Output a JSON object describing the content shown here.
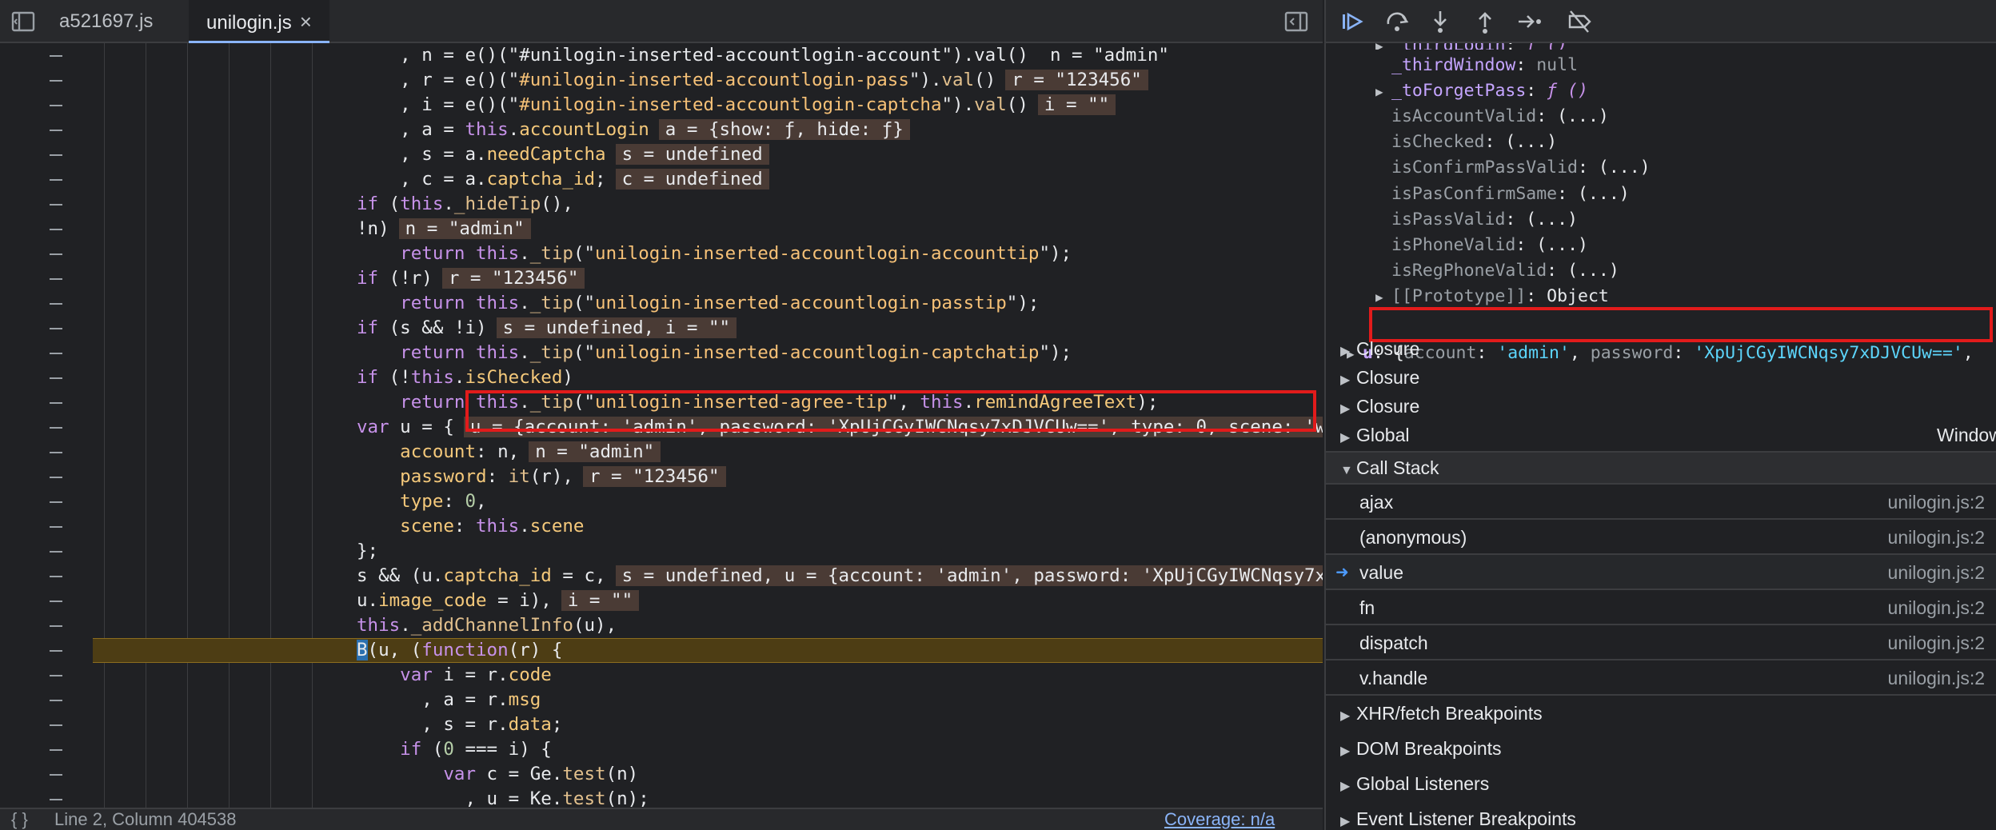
{
  "tabs": [
    {
      "label": "a521697.js",
      "active": false
    },
    {
      "label": "unilogin.js",
      "active": true,
      "close": "×"
    }
  ],
  "code_lines": [
    [
      [
        "pl",
        "    , n = e()(\"#unilogin-inserted-accountlogin-account\").val()  n = \"admin\""
      ]
    ],
    [
      [
        "pl",
        "    , r = e()(\""
      ],
      [
        "str",
        "#unilogin-inserted-accountlogin-pass"
      ],
      [
        "pl",
        "\")."
      ],
      [
        "fn",
        "val"
      ],
      [
        "pl",
        "()"
      ],
      [
        "inl",
        "r = \"123456\""
      ]
    ],
    [
      [
        "pl",
        "    , i = e()(\""
      ],
      [
        "str",
        "#unilogin-inserted-accountlogin-captcha"
      ],
      [
        "pl",
        "\")."
      ],
      [
        "fn",
        "val"
      ],
      [
        "pl",
        "()"
      ],
      [
        "inl",
        "i = \"\""
      ]
    ],
    [
      [
        "pl",
        "    , a = "
      ],
      [
        "kw",
        "this"
      ],
      [
        "pl",
        "."
      ],
      [
        "prop",
        "accountLogin"
      ],
      [
        "inl",
        "a = {show: ƒ, hide: ƒ}"
      ]
    ],
    [
      [
        "pl",
        "    , s = a."
      ],
      [
        "prop",
        "needCaptcha"
      ],
      [
        "inl",
        "s = undefined"
      ]
    ],
    [
      [
        "pl",
        "    , c = a."
      ],
      [
        "prop",
        "captcha_id"
      ],
      [
        "pl",
        ";"
      ],
      [
        "inl",
        "c = undefined"
      ]
    ],
    [
      [
        "kw",
        "if"
      ],
      [
        "pl",
        " ("
      ],
      [
        "kw",
        "this"
      ],
      [
        "pl",
        "."
      ],
      [
        "fn",
        "_hideTip"
      ],
      [
        "pl",
        "(),"
      ]
    ],
    [
      [
        "pl",
        "!n)"
      ],
      [
        "inl",
        "n = \"admin\""
      ]
    ],
    [
      [
        "kw",
        "    return this"
      ],
      [
        "pl",
        "."
      ],
      [
        "fn",
        "_tip"
      ],
      [
        "pl",
        "(\""
      ],
      [
        "str",
        "unilogin-inserted-accountlogin-accounttip"
      ],
      [
        "pl",
        "\");"
      ]
    ],
    [
      [
        "kw",
        "if"
      ],
      [
        "pl",
        " (!r)"
      ],
      [
        "inl",
        "r = \"123456\""
      ]
    ],
    [
      [
        "kw",
        "    return this"
      ],
      [
        "pl",
        "."
      ],
      [
        "fn",
        "_tip"
      ],
      [
        "pl",
        "(\""
      ],
      [
        "str",
        "unilogin-inserted-accountlogin-passtip"
      ],
      [
        "pl",
        "\");"
      ]
    ],
    [
      [
        "kw",
        "if"
      ],
      [
        "pl",
        " (s && !i)"
      ],
      [
        "inl",
        "s = undefined, i = \"\""
      ]
    ],
    [
      [
        "kw",
        "    return this"
      ],
      [
        "pl",
        "."
      ],
      [
        "fn",
        "_tip"
      ],
      [
        "pl",
        "(\""
      ],
      [
        "str",
        "unilogin-inserted-accountlogin-captchatip"
      ],
      [
        "pl",
        "\");"
      ]
    ],
    [
      [
        "kw",
        "if"
      ],
      [
        "pl",
        " (!"
      ],
      [
        "kw",
        "this"
      ],
      [
        "pl",
        "."
      ],
      [
        "prop",
        "isChecked"
      ],
      [
        "pl",
        ")"
      ]
    ],
    [
      [
        "kw",
        "    return this"
      ],
      [
        "pl",
        "."
      ],
      [
        "fn",
        "_tip"
      ],
      [
        "pl",
        "(\""
      ],
      [
        "str",
        "unilogin-inserted-agree-tip"
      ],
      [
        "pl",
        "\", "
      ],
      [
        "kw",
        "this"
      ],
      [
        "pl",
        "."
      ],
      [
        "prop",
        "remindAgreeText"
      ],
      [
        "pl",
        ");"
      ]
    ],
    [
      [
        "kw",
        "var"
      ],
      [
        "pl",
        " u = {"
      ],
      [
        "inl",
        "u = {account: 'admin', password: 'XpUjCGyIWCNqsy7xDJVCUw==', type: 0, scene: 'we"
      ]
    ],
    [
      [
        "prop",
        "    account"
      ],
      [
        "pl",
        ": n,"
      ],
      [
        "inl",
        "n = \"admin\""
      ]
    ],
    [
      [
        "prop",
        "    password"
      ],
      [
        "pl",
        ": "
      ],
      [
        "fn",
        "it"
      ],
      [
        "pl",
        "(r),"
      ],
      [
        "inl",
        "r = \"123456\""
      ]
    ],
    [
      [
        "prop",
        "    type"
      ],
      [
        "pl",
        ": "
      ],
      [
        "num",
        "0"
      ],
      [
        "pl",
        ","
      ]
    ],
    [
      [
        "prop",
        "    scene"
      ],
      [
        "pl",
        ": "
      ],
      [
        "kw",
        "this"
      ],
      [
        "pl",
        "."
      ],
      [
        "prop",
        "scene"
      ]
    ],
    [
      [
        "pl",
        "};"
      ]
    ],
    [
      [
        "pl",
        "s && (u."
      ],
      [
        "prop",
        "captcha_id"
      ],
      [
        "pl",
        " = c,"
      ],
      [
        "inl",
        "s = undefined, u = {account: 'admin', password: 'XpUjCGyIWCNqsy7xD"
      ]
    ],
    [
      [
        "pl",
        "u."
      ],
      [
        "prop",
        "image_code"
      ],
      [
        "pl",
        " = i),"
      ],
      [
        "inl",
        "i = \"\""
      ]
    ],
    [
      [
        "kw",
        "this"
      ],
      [
        "pl",
        "."
      ],
      [
        "fn",
        "_addChannelInfo"
      ],
      [
        "pl",
        "(u),"
      ]
    ],
    [
      [
        "cur",
        "B"
      ],
      [
        "pl",
        "(u, ("
      ],
      [
        "kw",
        "function"
      ],
      [
        "pl",
        "(r) {"
      ]
    ],
    [
      [
        "kw",
        "    var"
      ],
      [
        "pl",
        " i = r."
      ],
      [
        "prop",
        "code"
      ]
    ],
    [
      [
        "pl",
        "      , a = r."
      ],
      [
        "prop",
        "msg"
      ]
    ],
    [
      [
        "pl",
        "      , s = r."
      ],
      [
        "prop",
        "data"
      ],
      [
        "pl",
        ";"
      ]
    ],
    [
      [
        "kw",
        "    if"
      ],
      [
        "pl",
        " ("
      ],
      [
        "num",
        "0"
      ],
      [
        "pl",
        " === i) {"
      ]
    ],
    [
      [
        "kw",
        "        var"
      ],
      [
        "pl",
        " c = Ge."
      ],
      [
        "fn",
        "test"
      ],
      [
        "pl",
        "(n)"
      ]
    ],
    [
      [
        "pl",
        "          , u = Ke."
      ],
      [
        "fn",
        "test"
      ],
      [
        "pl",
        "(n);"
      ]
    ],
    [
      [
        "kw",
        "        return"
      ],
      [
        "pl",
        " t."
      ],
      [
        "fn",
        "_getToken"
      ],
      [
        "pl",
        "(s, \""
      ],
      [
        "str",
        "login"
      ],
      [
        "pl",
        "\", {"
      ]
    ]
  ],
  "status": {
    "braces": "{ }",
    "position": "Line 2, Column 404538",
    "coverage": "Coverage: n/a"
  },
  "scope": [
    {
      "indent": 1,
      "expand": true,
      "key": "_thirdLogin",
      "val": "ƒ ()",
      "valtype": "vf",
      "bold": true
    },
    {
      "indent": 1,
      "expand": false,
      "key": "_thirdWindow",
      "val": "null",
      "valtype": "vn",
      "bold": true
    },
    {
      "indent": 1,
      "expand": true,
      "key": "_toForgetPass",
      "val": "ƒ ()",
      "valtype": "vf",
      "bold": true
    },
    {
      "indent": 1,
      "expand": false,
      "key": "isAccountValid",
      "val": "(...)",
      "valtype": "v",
      "bold": false
    },
    {
      "indent": 1,
      "expand": false,
      "key": "isChecked",
      "val": "(...)",
      "valtype": "v",
      "bold": false
    },
    {
      "indent": 1,
      "expand": false,
      "key": "isConfirmPassValid",
      "val": "(...)",
      "valtype": "v",
      "bold": false
    },
    {
      "indent": 1,
      "expand": false,
      "key": "isPasConfirmSame",
      "val": "(...)",
      "valtype": "v",
      "bold": false
    },
    {
      "indent": 1,
      "expand": false,
      "key": "isPassValid",
      "val": "(...)",
      "valtype": "v",
      "bold": false
    },
    {
      "indent": 1,
      "expand": false,
      "key": "isPhoneValid",
      "val": "(...)",
      "valtype": "v",
      "bold": false
    },
    {
      "indent": 1,
      "expand": false,
      "key": "isRegPhoneValid",
      "val": "(...)",
      "valtype": "v",
      "bold": false
    },
    {
      "indent": 1,
      "expand": true,
      "key": "[[Prototype]]",
      "val": "Object",
      "valtype": "v",
      "bold": false
    }
  ],
  "scope_u": {
    "key": "u",
    "open": "{",
    "k1": "account",
    "v1": "'admin'",
    "k2": "password",
    "v2": "'XpUjCGyIWCNqsy7xDJVCUw=='",
    "tail": ","
  },
  "closures": [
    "Closure",
    "Closure",
    "Closure"
  ],
  "global": {
    "label": "Global",
    "value": "Window"
  },
  "call_stack": {
    "header": "Call Stack",
    "frames": [
      {
        "name": "ajax",
        "loc": "unilogin.js:2",
        "current": false
      },
      {
        "name": "(anonymous)",
        "loc": "unilogin.js:2",
        "current": false
      },
      {
        "name": "value",
        "loc": "unilogin.js:2",
        "current": true
      },
      {
        "name": "fn",
        "loc": "unilogin.js:2",
        "current": false
      },
      {
        "name": "dispatch",
        "loc": "unilogin.js:2",
        "current": false
      },
      {
        "name": "v.handle",
        "loc": "unilogin.js:2",
        "current": false
      }
    ]
  },
  "breakpoint_sections": [
    "XHR/fetch Breakpoints",
    "DOM Breakpoints",
    "Global Listeners",
    "Event Listener Breakpoints"
  ],
  "colors": {
    "highlight_box": "#e21b1b",
    "exec_line": "#4d3d14",
    "accent": "#8ab4f8"
  }
}
